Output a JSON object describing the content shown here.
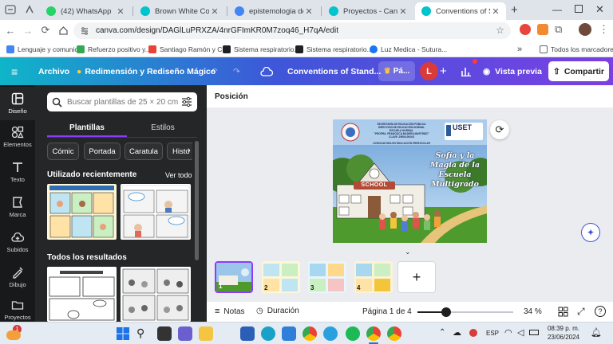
{
  "browser": {
    "tabs": [
      {
        "title": "(42) WhatsApp",
        "color": "#25d366"
      },
      {
        "title": "Brown White Collage T...",
        "color": "#00c4cc"
      },
      {
        "title": "epistemologia del sur g...",
        "color": "#4285f4"
      },
      {
        "title": "Proyectos - Canva",
        "color": "#00c4cc"
      },
      {
        "title": "Conventions of Standa...",
        "color": "#00c4cc"
      }
    ],
    "url": "canva.com/design/DAGlLuPRXZA/4nrGFImKR0M7zoq46_H7qA/edit",
    "bookmarks": [
      {
        "label": "Lenguaje y comunic...",
        "color": "#4285f4"
      },
      {
        "label": "Refuerzo positivo y...",
        "color": "#34a853"
      },
      {
        "label": "Santiago Ramón y C...",
        "color": "#ea4335"
      },
      {
        "label": "Sistema respiratorio...",
        "color": "#202124"
      },
      {
        "label": "Sistema respiratorio...",
        "color": "#202124"
      },
      {
        "label": "Luz Medica - Sutura...",
        "color": "#1877f2"
      }
    ],
    "all_bookmarks": "Todos los marcadores"
  },
  "canva": {
    "menu_file": "Archivo",
    "resize_label": "Redimensión y Rediseño Mágico",
    "doc_title": "Conventions of Stand...",
    "pro_label": "Pá...",
    "avatar_letter": "L",
    "preview_label": "Vista previa",
    "share_label": "Compartir",
    "rail": [
      {
        "label": "Diseño",
        "icon": "layout-icon"
      },
      {
        "label": "Elementos",
        "icon": "shapes-icon"
      },
      {
        "label": "Texto",
        "icon": "text-icon"
      },
      {
        "label": "Marca",
        "icon": "brand-icon"
      },
      {
        "label": "Subidos",
        "icon": "cloud-upload-icon"
      },
      {
        "label": "Dibujo",
        "icon": "draw-icon"
      },
      {
        "label": "Proyectos",
        "icon": "folder-icon"
      }
    ],
    "search_placeholder": "Buscar plantillas de 25 × 20 cm",
    "panel_tabs": [
      "Plantillas",
      "Estilos"
    ],
    "chips": [
      "Cómic",
      "Portada",
      "Caratula",
      "Histo"
    ],
    "recent_heading": "Utilizado recientemente",
    "see_all": "Ver todo",
    "all_results_heading": "Todos los resultados",
    "position_label": "Posición",
    "design": {
      "header_lines": [
        "SECRETARÍA DE EDUCACIÓN PÚBLICA",
        "DIRECCIÓN DE EDUCACIÓN NORMAL",
        "ESCUELA NORMAL",
        "\"PROFRA. FRANCISCA MADERA MARTÍNEZ\"",
        "CLAVE: 29ENL0004S"
      ],
      "sub_line": "LICENCIATURA EN EDUCACIÓN PREESCOLAR",
      "logo_text": "USET",
      "school_sign": "SCHOOL",
      "title_lines": [
        "Sofía y la",
        "Magia de la",
        "Escuela",
        "Multigrado"
      ]
    },
    "pages": [
      "1",
      "2",
      "3",
      "4"
    ],
    "footer": {
      "notes": "Notas",
      "duration": "Duración",
      "page_indicator": "Página 1 de 4",
      "zoom": "34 %",
      "zoom_fraction": 0.3
    }
  },
  "taskbar": {
    "lang": "ESP",
    "time": "08:39 p. m.",
    "date": "23/06/2024",
    "notification_count": "1"
  }
}
